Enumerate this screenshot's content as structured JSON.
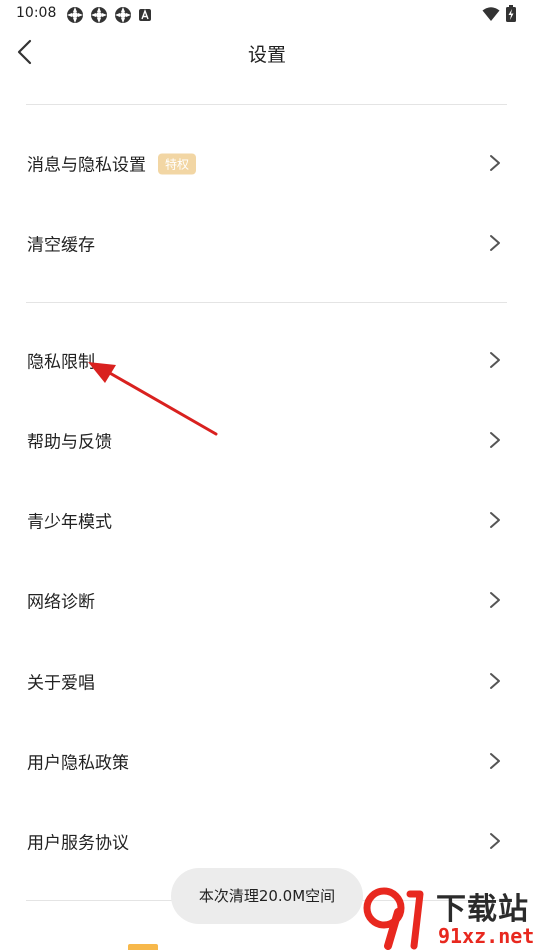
{
  "status_bar": {
    "time": "10:08",
    "notification_icons": [
      "app-notification-icon",
      "app-notification-icon",
      "app-notification-icon",
      "a-notification-icon"
    ],
    "right_icons": [
      "wifi-icon",
      "battery-charging-icon"
    ]
  },
  "header": {
    "title": "设置",
    "back_icon": "chevron-left-icon"
  },
  "settings": {
    "group1": [
      {
        "label": "消息与隐私设置",
        "badge": "特权"
      },
      {
        "label": "清空缓存"
      }
    ],
    "group2": [
      {
        "label": "隐私限制"
      },
      {
        "label": "帮助与反馈"
      },
      {
        "label": "青少年模式"
      },
      {
        "label": "网络诊断"
      },
      {
        "label": "关于爱唱"
      },
      {
        "label": "用户隐私政策"
      },
      {
        "label": "用户服务协议"
      }
    ]
  },
  "toast": {
    "text": "本次清理20.0M空间"
  },
  "watermark": {
    "text_top": "下载站",
    "text_bottom": "91xz.net"
  },
  "colors": {
    "badge_bg": "#f2d6a4",
    "annotation_arrow": "#d9211f",
    "divider": "#e4e4e4",
    "chevron": "#555555"
  }
}
